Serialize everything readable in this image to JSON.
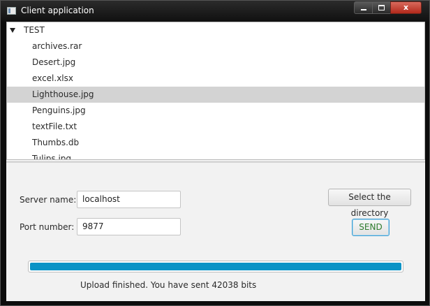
{
  "window": {
    "title": "Client application",
    "controls": {
      "minimize": "",
      "maximize": "",
      "close": "x"
    }
  },
  "tree": {
    "root": "TEST",
    "selected_index": 3,
    "items": [
      "archives.rar",
      "Desert.jpg",
      "excel.xlsx",
      "Lighthouse.jpg",
      "Penguins.jpg",
      "textFile.txt",
      "Thumbs.db",
      "Tulips.jpg"
    ]
  },
  "form": {
    "server_label": "Server name:",
    "server_value": "localhost",
    "port_label": "Port number:",
    "port_value": "9877",
    "select_dir_label": "Select the directory",
    "send_label": "SEND"
  },
  "progress": {
    "fraction": 1.0
  },
  "status": "Upload finished. You have sent 42038 bits",
  "colors": {
    "progress": "#0a93c6",
    "selection": "#d3d3d3",
    "close": "#c4392b"
  }
}
